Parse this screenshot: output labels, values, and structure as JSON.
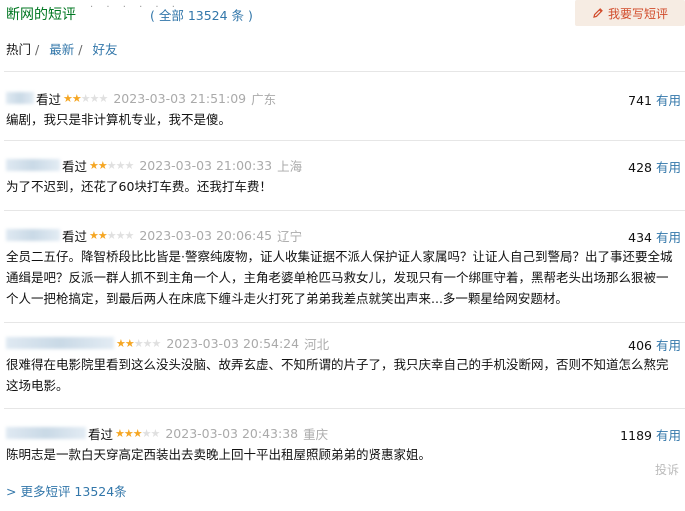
{
  "header": {
    "title": "断网的短评",
    "dots": "· · · · · ·",
    "total_text": "( 全部 13524 条 )",
    "write_button": "我要写短评",
    "write_icon": "pencil-icon"
  },
  "tabs": [
    {
      "label": "热门",
      "sep": "/"
    },
    {
      "label": "最新",
      "sep": "/"
    },
    {
      "label": "好友",
      "sep": ""
    }
  ],
  "comments": [
    {
      "watched": "看过",
      "rating": 2,
      "time": "2023-03-03 21:51:09",
      "location": "广东",
      "votes": "741",
      "useful": "有用",
      "text": "编剧，我只是非计算机专业，我不是傻。"
    },
    {
      "watched": "看过",
      "rating": 2,
      "time": "2023-03-03 21:00:33",
      "location": "上海",
      "votes": "428",
      "useful": "有用",
      "text": "为了不迟到，还花了60块打车费。还我打车费！"
    },
    {
      "watched": "看过",
      "rating": 2,
      "time": "2023-03-03 20:06:45",
      "location": "辽宁",
      "votes": "434",
      "useful": "有用",
      "text": "全员二五仔。降智桥段比比皆是·警察纯废物，证人收集证据不派人保护证人家属吗？让证人自己到警局？出了事还要全城通缉是吧？反派一群人抓不到主角一个人，主角老婆单枪匹马救女儿，发现只有一个绑匪守着，黑帮老头出场那么狠被一个人一把枪搞定，到最后两人在床底下缠斗走火打死了弟弟我差点就笑出声来...多一颗星给网安题材。"
    },
    {
      "watched": "看过",
      "rating": 2,
      "time": "2023-03-03 20:54:24",
      "location": "河北",
      "votes": "406",
      "useful": "有用",
      "text": "很难得在电影院里看到这么没头没脑、故弄玄虚、不知所谓的片子了，我只庆幸自己的手机没断网，否则不知道怎么熬完这场电影。"
    },
    {
      "watched": "看过",
      "rating": 3,
      "time": "2023-03-03 20:43:38",
      "location": "重庆",
      "votes": "1189",
      "useful": "有用",
      "text": "陈明志是一款白天穿高定西装出去卖晚上回十平出租屋照顾弟弟的贤惠家姐。"
    }
  ],
  "report_label": "投诉",
  "more_link": "> 更多短评 13524条"
}
